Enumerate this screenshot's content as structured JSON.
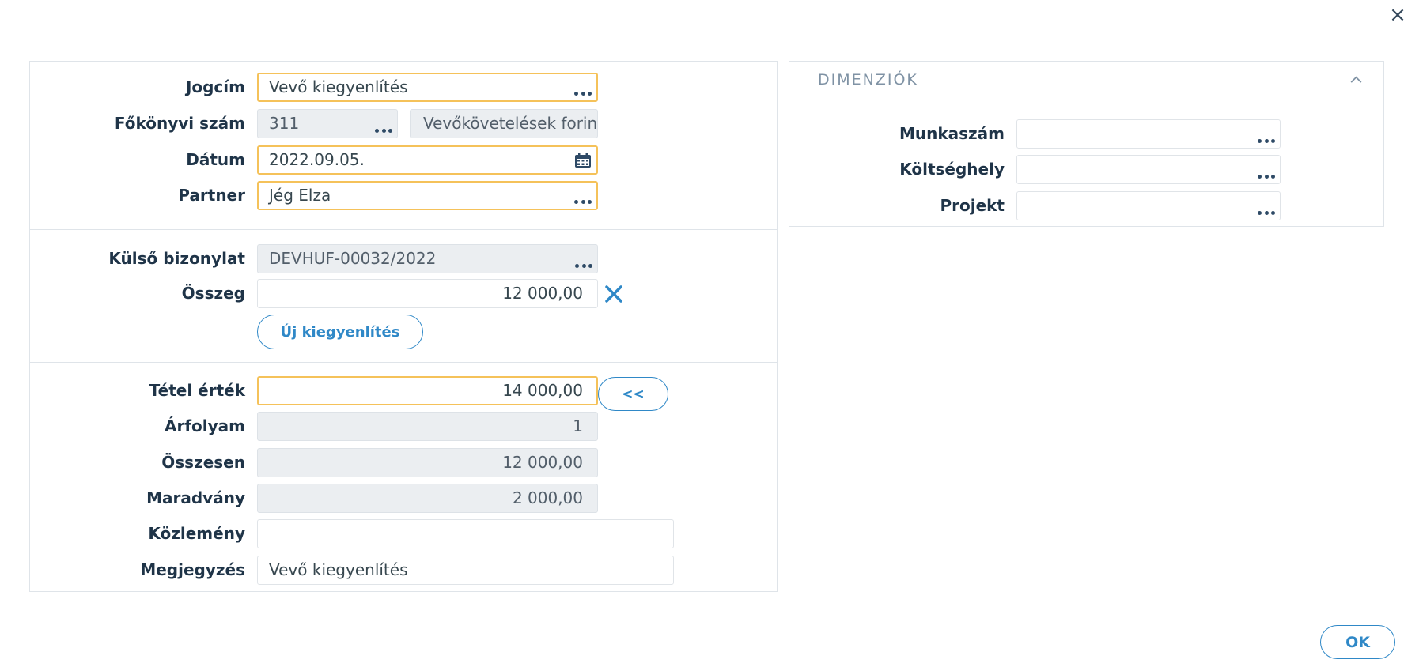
{
  "form": {
    "jogcim": {
      "label": "Jogcím",
      "value": "Vevő kiegyenlítés"
    },
    "fokonyvi": {
      "label": "Főkönyvi szám",
      "value": "311",
      "name_value": "Vevőkövetelések forin"
    },
    "datum": {
      "label": "Dátum",
      "value": "2022.09.05."
    },
    "partner": {
      "label": "Partner",
      "value": "Jég Elza"
    },
    "kulso": {
      "label": "Külső bizonylat",
      "value": "DEVHUF-00032/2022"
    },
    "osszeg": {
      "label": "Összeg",
      "value": "12 000,00"
    },
    "uj_button": "Új kiegyenlítés",
    "tetel": {
      "label": "Tétel érték",
      "value": "14 000,00",
      "copy_button": "<<"
    },
    "arfolyam": {
      "label": "Árfolyam",
      "value": "1"
    },
    "osszesen": {
      "label": "Összesen",
      "value": "12 000,00"
    },
    "maradvany": {
      "label": "Maradvány",
      "value": "2 000,00"
    },
    "kozlemeny": {
      "label": "Közlemény",
      "value": ""
    },
    "megjegyzes": {
      "label": "Megjegyzés",
      "value": "Vevő kiegyenlítés"
    }
  },
  "dimensions": {
    "title": "DIMENZIÓK",
    "munkaszam": {
      "label": "Munkaszám",
      "value": ""
    },
    "koltseghely": {
      "label": "Költséghely",
      "value": ""
    },
    "projekt": {
      "label": "Projekt",
      "value": ""
    }
  },
  "dialog": {
    "close_glyph": "×",
    "ok_button": "OK"
  },
  "colors": {
    "accent": "#2f88c7",
    "required_border": "#f5c25a",
    "readonly_bg": "#ebeef1",
    "label": "#1f3448"
  }
}
